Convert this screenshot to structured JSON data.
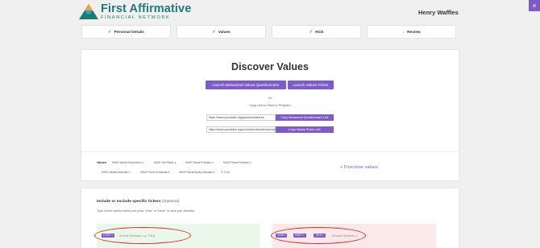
{
  "header": {
    "logo_title": "First Affirmative",
    "logo_subtitle": "FINANCIAL NETWORK",
    "user_name": "Henry Waffles",
    "close_label": "×"
  },
  "steps": [
    {
      "label": "Personal Details",
      "state": "complete"
    },
    {
      "label": "Values",
      "state": "complete"
    },
    {
      "label": "Risk",
      "state": "complete"
    },
    {
      "label": "Review",
      "state": "current"
    }
  ],
  "discover": {
    "title": "Discover Values",
    "launch_questionnaire": "Launch Behavioral Values Questionnaire",
    "launch_picker": "Launch Values Picker",
    "or": "Or",
    "copy_link_text": "Copy Link to Send to Prospect",
    "questionnaire_url": "https://www.yourstake.org/questionnaire/au",
    "copy_questionnaire_label": "Copy Behavioral Questionnaire Link",
    "picker_url": "https://www.yourstake.org/u/robotornetw/advisor/val",
    "copy_picker_label": "Copy Values Picker Link"
  },
  "values": {
    "label": "Values",
    "items": [
      "HAVE Worker Empowerm",
      "HAVE Fair Player",
      "HAVE Planet Protector",
      "HAVE Peace Protector",
      "HAVE Health Defender",
      "HAVE Friend of Animals",
      "HAVE Racial Equity Advocate"
    ],
    "edit_label": "Edit",
    "fine_tune_label": "Fine-tune values"
  },
  "tickers": {
    "title": "Include or exclude specific tickers",
    "optional": "(Optional)",
    "help": "Type a ticker symbol below and press \"enter\" or \"return\" to save your selection.",
    "include_chips": [
      "COST"
    ],
    "include_placeholder": "Include Symbols, e.g. TSLA",
    "exclude_chips": [
      "XOM",
      "MSFT",
      "TSLA"
    ],
    "exclude_placeholder": "Exclude Symbols, e"
  },
  "colors": {
    "accent": "#7d5bc9",
    "brand": "#1f7a72",
    "complete": "#3a9d65",
    "annotation": "#dd2222"
  }
}
